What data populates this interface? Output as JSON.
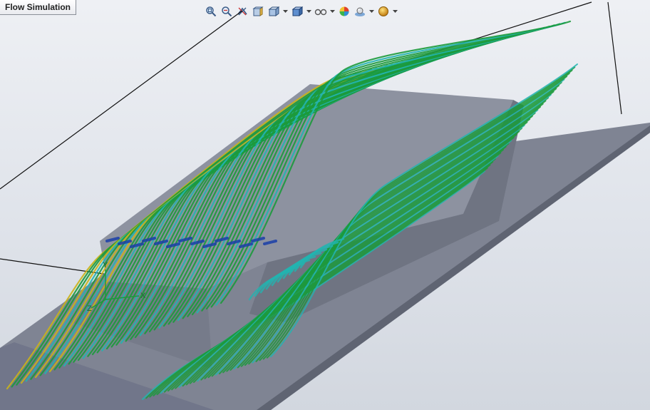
{
  "app": {
    "tab_label": "Flow Simulation"
  },
  "toolbar": {
    "items": [
      {
        "icon": "zoom-to-fit-icon"
      },
      {
        "icon": "zoom-to-area-icon"
      },
      {
        "icon": "previous-view-icon"
      },
      {
        "icon": "section-view-icon"
      },
      {
        "icon": "view-orientation-icon"
      },
      {
        "icon": "display-style-icon"
      },
      {
        "icon": "hide-show-items-icon"
      },
      {
        "icon": "edit-appearance-icon"
      },
      {
        "icon": "apply-scene-icon"
      },
      {
        "icon": "view-settings-icon"
      }
    ]
  },
  "triad": {
    "y": "Y",
    "x": "X",
    "z": "Z"
  },
  "colors": {
    "plate_top": "#7f8493",
    "plate_side": "#5f6472",
    "model_top": "#8d92a0",
    "model_side": "#6f7482",
    "streamline_green": "#1c9a3c",
    "streamline_cyan": "#22b4b0",
    "streamline_blue": "#1a3ea8",
    "streamline_yellow": "#c9b418",
    "bbox_line": "#111111"
  }
}
